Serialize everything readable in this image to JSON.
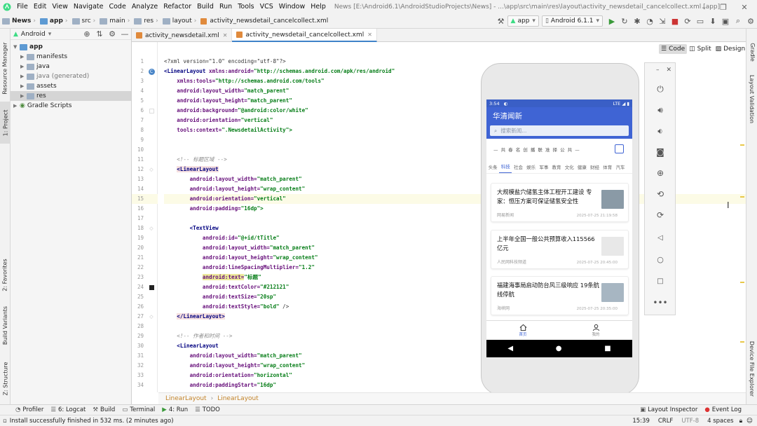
{
  "window": {
    "menu": [
      "File",
      "Edit",
      "View",
      "Navigate",
      "Code",
      "Analyze",
      "Refactor",
      "Build",
      "Run",
      "Tools",
      "VCS",
      "Window",
      "Help"
    ],
    "title": "News [E:\\Android6.1\\AndroidStudioProjects\\News] - ...\\app\\src\\main\\res\\layout\\activity_newsdetail_cancelcollect.xml [app]"
  },
  "navbar": {
    "crumbs": [
      "News",
      "app",
      "src",
      "main",
      "res",
      "layout",
      "activity_newsdetail_cancelcollect.xml"
    ],
    "run_config": "app",
    "device": "Android 6.1.1"
  },
  "project_panel": {
    "view_mode": "Android",
    "tree": [
      {
        "label": "app",
        "level": 0,
        "expanded": true,
        "bold": true
      },
      {
        "label": "manifests",
        "level": 1
      },
      {
        "label": "java",
        "level": 1
      },
      {
        "label": "java (generated)",
        "level": 1
      },
      {
        "label": "assets",
        "level": 1
      },
      {
        "label": "res",
        "level": 1,
        "selected": true
      },
      {
        "label": "Gradle Scripts",
        "level": 0
      }
    ]
  },
  "left_strip": {
    "tabs": [
      "Resource Manager",
      "1: Project",
      "2: Favorites",
      "Build Variants",
      "Z: Structure"
    ]
  },
  "right_strip": {
    "tabs": [
      "Gradle",
      "Layout Validation",
      "Device File Explorer"
    ]
  },
  "editor": {
    "tabs": [
      {
        "label": "activity_newsdetail.xml",
        "active": false
      },
      {
        "label": "activity_newsdetail_cancelcollect.xml",
        "active": true
      }
    ],
    "view_modes": [
      "Code",
      "Split",
      "Design"
    ],
    "line_numbers": [
      "1",
      "2",
      "3",
      "4",
      "5",
      "6",
      "7",
      "8",
      "9",
      "10",
      "11",
      "12",
      "13",
      "14",
      "15",
      "16",
      "17",
      "18",
      "19",
      "20",
      "21",
      "22",
      "23",
      "24",
      "25",
      "26",
      "27",
      "28",
      "29",
      "30",
      "31",
      "32",
      "33",
      "34"
    ],
    "lines": [
      [
        [
          "p",
          "<?xml version=\"1.0\" encoding=\"utf-8\"?>"
        ]
      ],
      [
        [
          "t",
          "<LinearLayout "
        ],
        [
          "a",
          "xmlns:android="
        ],
        [
          "s",
          "\"http://schemas.android.com/apk/res/android\""
        ]
      ],
      [
        [
          "p",
          "    "
        ],
        [
          "a",
          "xmlns:tools="
        ],
        [
          "s",
          "\"http://schemas.android.com/tools\""
        ]
      ],
      [
        [
          "p",
          "    "
        ],
        [
          "a",
          "android:layout_width="
        ],
        [
          "s",
          "\"match_parent\""
        ]
      ],
      [
        [
          "p",
          "    "
        ],
        [
          "a",
          "android:layout_height="
        ],
        [
          "s",
          "\"match_parent\""
        ]
      ],
      [
        [
          "p",
          "    "
        ],
        [
          "a",
          "android:background="
        ],
        [
          "s",
          "\"@android:color/white\""
        ]
      ],
      [
        [
          "p",
          "    "
        ],
        [
          "a",
          "android:orientation="
        ],
        [
          "s",
          "\"vertical\""
        ]
      ],
      [
        [
          "p",
          "    "
        ],
        [
          "a",
          "tools:context="
        ],
        [
          "s",
          "\".NewsdetailActivity\">"
        ]
      ],
      [],
      [],
      [
        [
          "p",
          "    "
        ],
        [
          "c",
          "<!-- 标题区域 -->"
        ]
      ],
      [
        [
          "p",
          "    "
        ],
        [
          "t",
          "<LinearLayout"
        ]
      ],
      [
        [
          "p",
          "        "
        ],
        [
          "a",
          "android:layout_width="
        ],
        [
          "s",
          "\"match_parent\""
        ]
      ],
      [
        [
          "p",
          "        "
        ],
        [
          "a",
          "android:layout_height="
        ],
        [
          "s",
          "\"wrap_content\""
        ]
      ],
      [
        [
          "p",
          "        "
        ],
        [
          "a",
          "android:orientation="
        ],
        [
          "s",
          "\"vertical\""
        ]
      ],
      [
        [
          "p",
          "        "
        ],
        [
          "a",
          "android:padding="
        ],
        [
          "s",
          "\"16dp\">"
        ]
      ],
      [],
      [
        [
          "p",
          "        "
        ],
        [
          "t",
          "<TextView"
        ]
      ],
      [
        [
          "p",
          "            "
        ],
        [
          "a",
          "android:id="
        ],
        [
          "s",
          "\"@+id/tTitle\""
        ]
      ],
      [
        [
          "p",
          "            "
        ],
        [
          "a",
          "android:layout_width="
        ],
        [
          "s",
          "\"match_parent\""
        ]
      ],
      [
        [
          "p",
          "            "
        ],
        [
          "a",
          "android:layout_height="
        ],
        [
          "s",
          "\"wrap_content\""
        ]
      ],
      [
        [
          "p",
          "            "
        ],
        [
          "a",
          "android:lineSpacingMultiplier="
        ],
        [
          "s",
          "\"1.2\""
        ]
      ],
      [
        [
          "p",
          "            "
        ],
        [
          "a",
          "android:text="
        ],
        [
          "s",
          "\"标题\""
        ]
      ],
      [
        [
          "p",
          "            "
        ],
        [
          "a",
          "android:textColor="
        ],
        [
          "s",
          "\"#212121\""
        ]
      ],
      [
        [
          "p",
          "            "
        ],
        [
          "a",
          "android:textSize="
        ],
        [
          "s",
          "\"20sp\""
        ]
      ],
      [
        [
          "p",
          "            "
        ],
        [
          "a",
          "android:textStyle="
        ],
        [
          "s",
          "\"bold\""
        ],
        [
          "p",
          " />"
        ]
      ],
      [
        [
          "p",
          "    "
        ],
        [
          "t",
          "</LinearLayout>"
        ]
      ],
      [],
      [
        [
          "p",
          "    "
        ],
        [
          "c",
          "<!-- 作者和时间 -->"
        ]
      ],
      [
        [
          "p",
          "    "
        ],
        [
          "t",
          "<LinearLayout"
        ]
      ],
      [
        [
          "p",
          "        "
        ],
        [
          "a",
          "android:layout_width="
        ],
        [
          "s",
          "\"match_parent\""
        ]
      ],
      [
        [
          "p",
          "        "
        ],
        [
          "a",
          "android:layout_height="
        ],
        [
          "s",
          "\"wrap_content\""
        ]
      ],
      [
        [
          "p",
          "        "
        ],
        [
          "a",
          "android:orientation="
        ],
        [
          "s",
          "\"horizontal\""
        ]
      ],
      [
        [
          "p",
          "        "
        ],
        [
          "a",
          "android:paddingStart="
        ],
        [
          "s",
          "\"16dp\""
        ]
      ]
    ],
    "breadcrumb": [
      "LinearLayout",
      "LinearLayout"
    ]
  },
  "phone": {
    "status_time": "3:54",
    "status_right": "LTE ◢ ▮",
    "app_title": "华清闻新",
    "search_placeholder": "搜索新闻...",
    "hot_banner": "— 共 春 名 创 播 联 准 择 公 共 —",
    "categories": [
      "头条",
      "科技",
      "社会",
      "娱乐",
      "军事",
      "教育",
      "文化",
      "健康",
      "财经",
      "体育",
      "汽车"
    ],
    "active_category": "科技",
    "news": [
      {
        "title": "大规模盐穴储氢主体工程开工建设 专家：恒压方案可保证储氢安全性",
        "source": "网易新闻",
        "time": "2025-07-25 21:19:58",
        "thumb_color": "#8a9aa6"
      },
      {
        "title": "上半年全国一般公共预算收入115566亿元",
        "source": "人民网科技频道",
        "time": "2025-07-25 20:45:00",
        "thumb_color": "#e8e8e8"
      },
      {
        "title": "福建海事局启动防台风三级响应 19条航线停航",
        "source": "海峡网",
        "time": "2025-07-25 20:35:00",
        "thumb_color": "#a7b6c2"
      }
    ],
    "bottom_nav": [
      {
        "label": "首页",
        "icon": "home-icon",
        "active": true
      },
      {
        "label": "我的",
        "icon": "user-icon",
        "active": false
      }
    ]
  },
  "tool_windows": [
    {
      "label": "Profiler",
      "icon": "profiler-icon"
    },
    {
      "label": "6: Logcat",
      "icon": "logcat-icon"
    },
    {
      "label": "Build",
      "icon": "hammer-icon"
    },
    {
      "label": "Terminal",
      "icon": "terminal-icon"
    },
    {
      "label": "4: Run",
      "icon": "play-icon"
    },
    {
      "label": "TODO",
      "icon": "todo-icon"
    }
  ],
  "tool_windows_right": [
    {
      "label": "Layout Inspector",
      "icon": "inspector-icon"
    },
    {
      "label": "Event Log",
      "icon": "event-log-icon"
    }
  ],
  "status": {
    "message": "Install successfully finished in 532 ms. (2 minutes ago)",
    "position": "15:39",
    "line_sep": "CRLF",
    "encoding": "UTF-8",
    "indent": "4 spaces"
  },
  "colors": {
    "accent": "#3f64d4",
    "selection": "#d5d5d5",
    "string": "#067d17",
    "attr": "#660e7a",
    "tag": "#000080"
  }
}
